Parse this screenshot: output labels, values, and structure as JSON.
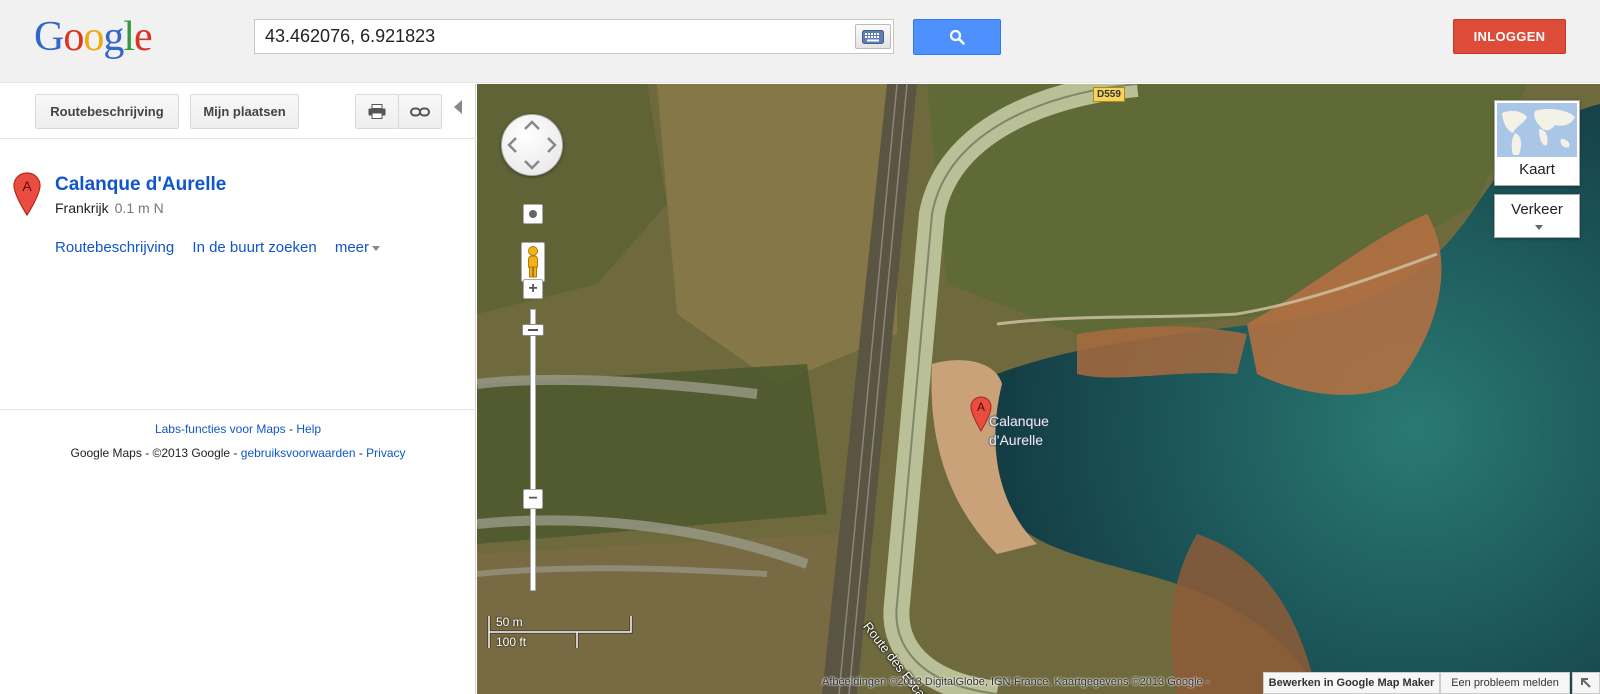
{
  "header": {
    "logo_letters": [
      "G",
      "o",
      "o",
      "g",
      "l",
      "e"
    ],
    "search_value": "43.462076, 6.921823",
    "keyboard_icon": "keyboard-icon",
    "search_icon": "search-icon",
    "login_label": "INLOGGEN"
  },
  "panel": {
    "toolbar": {
      "directions_label": "Routebeschrijving",
      "my_places_label": "Mijn plaatsen",
      "print_icon": "print-icon",
      "link_icon": "link-icon"
    },
    "result": {
      "marker": "A",
      "title": "Calanque d'Aurelle",
      "country": "Frankrijk",
      "distance": "0.1 m N",
      "links": {
        "directions": "Routebeschrijving",
        "nearby": "In de buurt zoeken",
        "more": "meer"
      }
    },
    "footer": {
      "labs": "Labs-functies voor Maps",
      "sep1": " - ",
      "help": "Help",
      "copyright": "Google Maps - ©2013 Google - ",
      "terms": "gebruiksvoorwaarden",
      "sep2": " - ",
      "privacy": "Privacy"
    }
  },
  "map": {
    "pin_marker": "A",
    "pin_label_line1": "Calanque",
    "pin_label_line2": "d'Aurelle",
    "road_label": "Route des Escalles",
    "road_shield": "D559",
    "scale_metric": "50 m",
    "scale_imperial": "100 ft",
    "map_type_label": "Kaart",
    "traffic_label": "Verkeer",
    "attribution": "Afbeeldingen ©2013 DigitalGlobe, IGN-France, Kaartgegevens ©2013 Google -",
    "edit_mapmaker_label": "Bewerken in Google Map Maker",
    "report_problem_label": "Een probleem melden",
    "colors": {
      "sea": "#1d5a5a",
      "land": "#6b6a3c",
      "road": "#b9bf97",
      "rocks": "#b9703f"
    }
  }
}
